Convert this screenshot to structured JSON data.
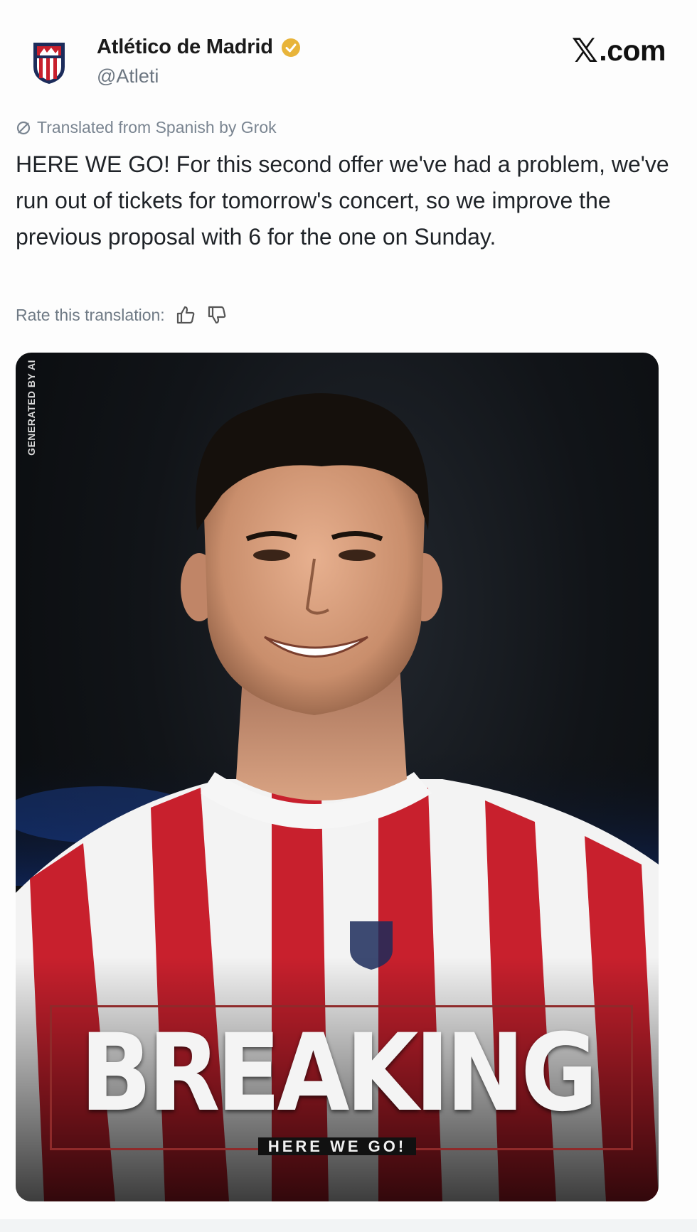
{
  "account": {
    "name": "Atlético de Madrid",
    "handle": "@Atleti",
    "verified_badge_color": "#e8b43a"
  },
  "brand": {
    "x_glyph": "𝕏",
    "suffix": ".com"
  },
  "tweet": {
    "translation_note": "Translated from Spanish by Grok",
    "text": "HERE WE GO! For this second offer we've had a problem, we've run out of tickets for tomorrow's concert, so we improve the previous proposal with 6 for the one on Sunday.",
    "rate_label": "Rate this translation:"
  },
  "media": {
    "ai_label": "GENERATED BY AI",
    "breaking_title": "BREAKING",
    "breaking_subtitle": "HERE WE GO!",
    "accent_color": "#8f2a2a",
    "jersey_colors": [
      "#c8202d",
      "#f3f3f3"
    ]
  }
}
